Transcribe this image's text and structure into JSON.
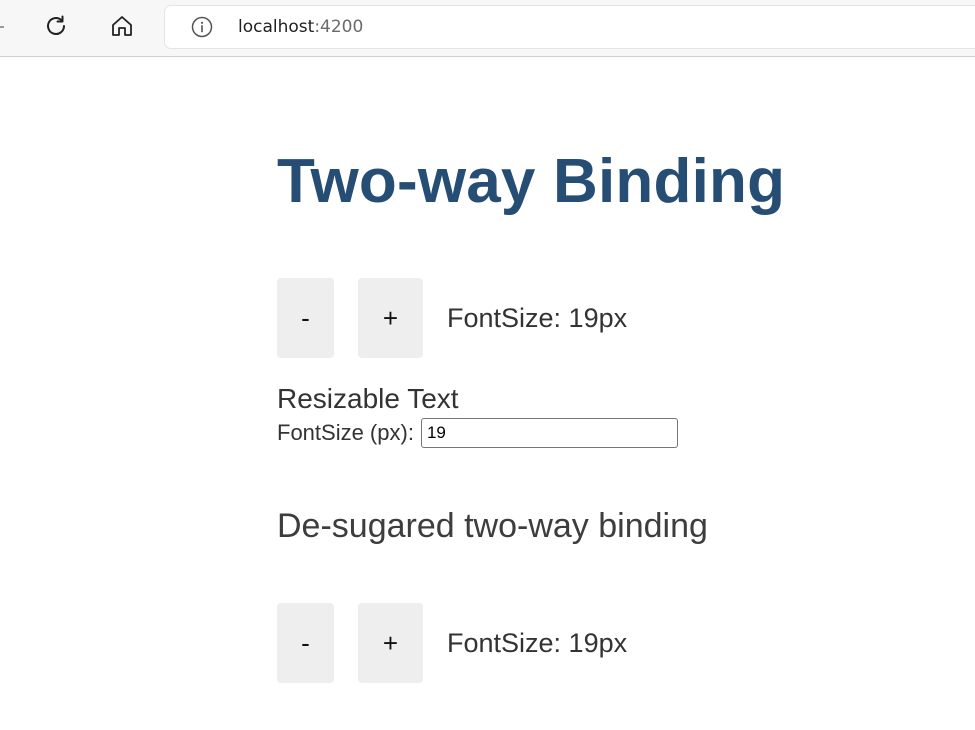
{
  "browser": {
    "url_host": "localhost",
    "url_port": ":4200"
  },
  "page": {
    "title": "Two-way Binding",
    "sizer1": {
      "dec_label": "-",
      "inc_label": "+",
      "font_size_label": "FontSize: 19px"
    },
    "resizable_text": "Resizable Text",
    "font_size_input": {
      "label": "FontSize (px):",
      "value": "19"
    },
    "desugared_heading": "De-sugared two-way binding",
    "sizer2": {
      "dec_label": "-",
      "inc_label": "+",
      "font_size_label": "FontSize: 19px"
    }
  },
  "colors": {
    "title": "#264d73",
    "button_bg": "#eeeeee",
    "text": "#333333"
  },
  "icons": {
    "reload": "reload-icon",
    "home": "home-icon",
    "info": "info-icon"
  }
}
